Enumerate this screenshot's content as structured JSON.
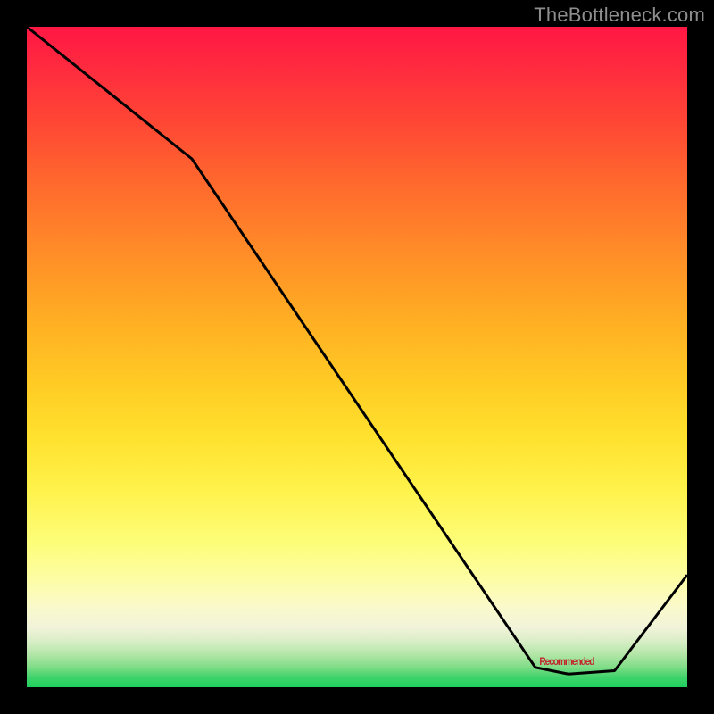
{
  "watermark": "TheBottleneck.com",
  "annotation_label": "Recommended",
  "chart_data": {
    "type": "line",
    "title": "",
    "xlabel": "",
    "ylabel": "",
    "xlim": [
      0,
      100
    ],
    "ylim": [
      0,
      100
    ],
    "grid": false,
    "axes_visible": false,
    "gradient_direction": "vertical",
    "gradient_stops": [
      {
        "pos": 0,
        "color": "#ff1744"
      },
      {
        "pos": 50,
        "color": "#ffcf23"
      },
      {
        "pos": 88,
        "color": "#fdfdc0"
      },
      {
        "pos": 100,
        "color": "#1ece5e"
      }
    ],
    "series": [
      {
        "name": "curve",
        "color": "#000000",
        "points": [
          {
            "x": 0,
            "y": 100
          },
          {
            "x": 25,
            "y": 80
          },
          {
            "x": 77,
            "y": 3
          },
          {
            "x": 82,
            "y": 2
          },
          {
            "x": 89,
            "y": 2.5
          },
          {
            "x": 100,
            "y": 17
          }
        ]
      }
    ],
    "annotations": [
      {
        "label_key": "annotation_label",
        "x": 82,
        "y": 3.5
      }
    ]
  }
}
